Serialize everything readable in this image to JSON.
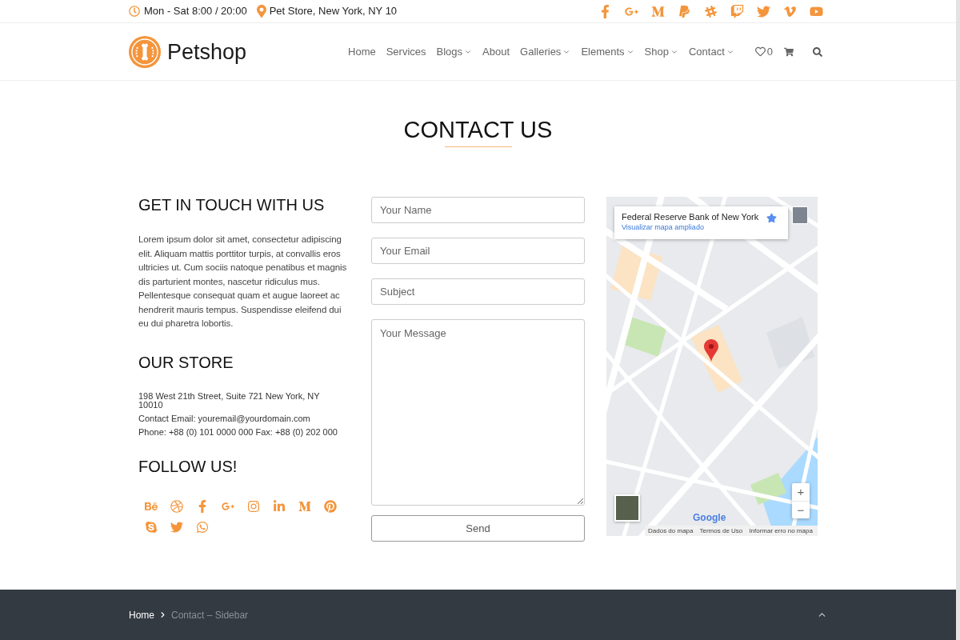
{
  "top_bar": {
    "hours": "Mon - Sat 8:00 / 20:00",
    "location": "Pet Store, New York, NY 10"
  },
  "header": {
    "logo_text": "Petshop",
    "nav": [
      {
        "label": "Home",
        "dropdown": false
      },
      {
        "label": "Services",
        "dropdown": false
      },
      {
        "label": "Blogs",
        "dropdown": true
      },
      {
        "label": "About",
        "dropdown": false
      },
      {
        "label": "Galleries",
        "dropdown": true
      },
      {
        "label": "Elements",
        "dropdown": true
      },
      {
        "label": "Shop",
        "dropdown": true
      },
      {
        "label": "Contact",
        "dropdown": true
      }
    ],
    "wishlist_count": "0"
  },
  "page_title": "CONTACT US",
  "get_in_touch": {
    "heading": "GET IN TOUCH WITH US",
    "text": "Lorem ipsum dolor sit amet, consectetur adipiscing elit. Aliquam mattis porttitor turpis, at convallis eros ultricies ut. Cum sociis natoque penatibus et magnis dis parturient montes, nascetur ridiculus mus. Pellentesque consequat quam et augue laoreet ac hendrerit mauris tempus. Suspendisse eleifend dui eu dui pharetra lobortis."
  },
  "our_store": {
    "heading": "OUR STORE",
    "address": "198 West 21th Street, Suite 721 New York, NY 10010",
    "lines": [
      "Contact Email: youremail@yourdomain.com",
      "Phone: +88 (0) 101 0000 000 Fax: +88 (0) 202 000"
    ]
  },
  "follow_us": {
    "heading": "FOLLOW US!"
  },
  "contact_form": {
    "fields": [
      {
        "kind": "input",
        "placeholder": "Your Name"
      },
      {
        "kind": "input",
        "placeholder": "Your Email"
      },
      {
        "kind": "input",
        "placeholder": "Subject"
      },
      {
        "kind": "textarea",
        "placeholder": "Your Message"
      }
    ],
    "submit": "Send"
  },
  "map": {
    "place_card": {
      "title": "Federal Reserve Bank of New York",
      "link": "Visualizar mapa ampliado"
    },
    "zoom_in": "+",
    "zoom_out": "−",
    "logo": "Google",
    "footer_links": [
      "Dados do mapa",
      "Termos de Uso",
      "Informar erro no mapa"
    ]
  },
  "breadcrumb": [
    {
      "label": "Home",
      "current": false
    },
    {
      "label": "Contact – Sidebar",
      "current": true
    }
  ]
}
